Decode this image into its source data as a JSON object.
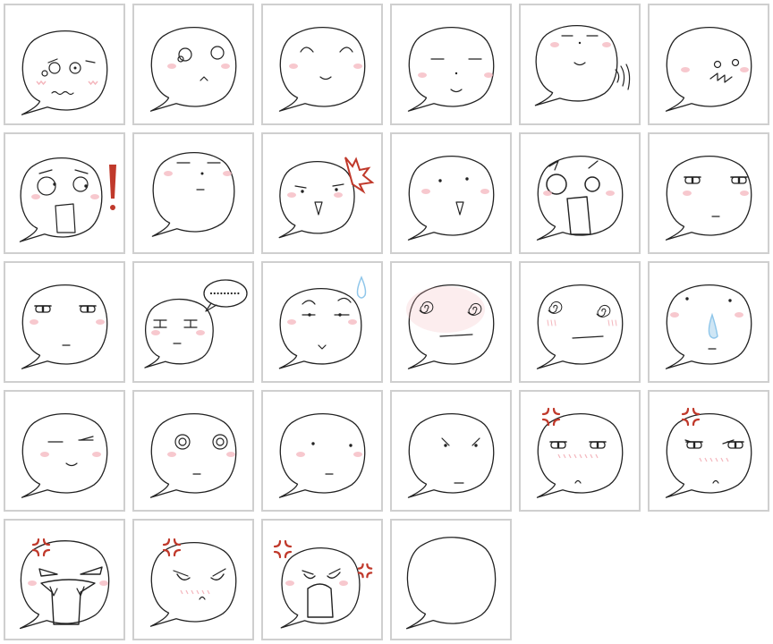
{
  "colors": {
    "border": "#cfcfcf",
    "line": "#222222",
    "blush": "#f4b6bd",
    "accent_red": "#c0392b",
    "sweat_blue": "#8fc6ea"
  },
  "stickers": [
    {
      "name": "nervous-face",
      "interactable": true
    },
    {
      "name": "surprised-face",
      "interactable": true
    },
    {
      "name": "happy-closed-eyes-face",
      "interactable": true
    },
    {
      "name": "calm-face",
      "interactable": true
    },
    {
      "name": "content-waving-face",
      "interactable": true
    },
    {
      "name": "wide-eyed-face",
      "interactable": true
    },
    {
      "name": "shocked-exclamation-face",
      "interactable": true
    },
    {
      "name": "neutral-face",
      "interactable": true
    },
    {
      "name": "angry-shouting-face",
      "interactable": true
    },
    {
      "name": "blank-stare-face",
      "interactable": true
    },
    {
      "name": "screaming-face",
      "interactable": true
    },
    {
      "name": "annoyed-side-eye-face",
      "interactable": true
    },
    {
      "name": "bored-side-eye-face",
      "interactable": true
    },
    {
      "name": "ellipsis-thinking-face",
      "interactable": true
    },
    {
      "name": "sweatdrop-face",
      "interactable": true
    },
    {
      "name": "dizzy-blushing-face",
      "interactable": true
    },
    {
      "name": "dizzy-face",
      "interactable": true
    },
    {
      "name": "runny-nose-face",
      "interactable": true
    },
    {
      "name": "smug-face",
      "interactable": true
    },
    {
      "name": "stunned-ring-eyes-face",
      "interactable": true
    },
    {
      "name": "dot-eyes-face",
      "interactable": true
    },
    {
      "name": "frowning-face",
      "interactable": true
    },
    {
      "name": "irritated-face",
      "interactable": true
    },
    {
      "name": "irritated-face-2",
      "interactable": true
    },
    {
      "name": "furious-fangs-face",
      "interactable": true
    },
    {
      "name": "angry-face",
      "interactable": true
    },
    {
      "name": "raging-face",
      "interactable": true
    },
    {
      "name": "empty-bubble",
      "interactable": true
    }
  ]
}
